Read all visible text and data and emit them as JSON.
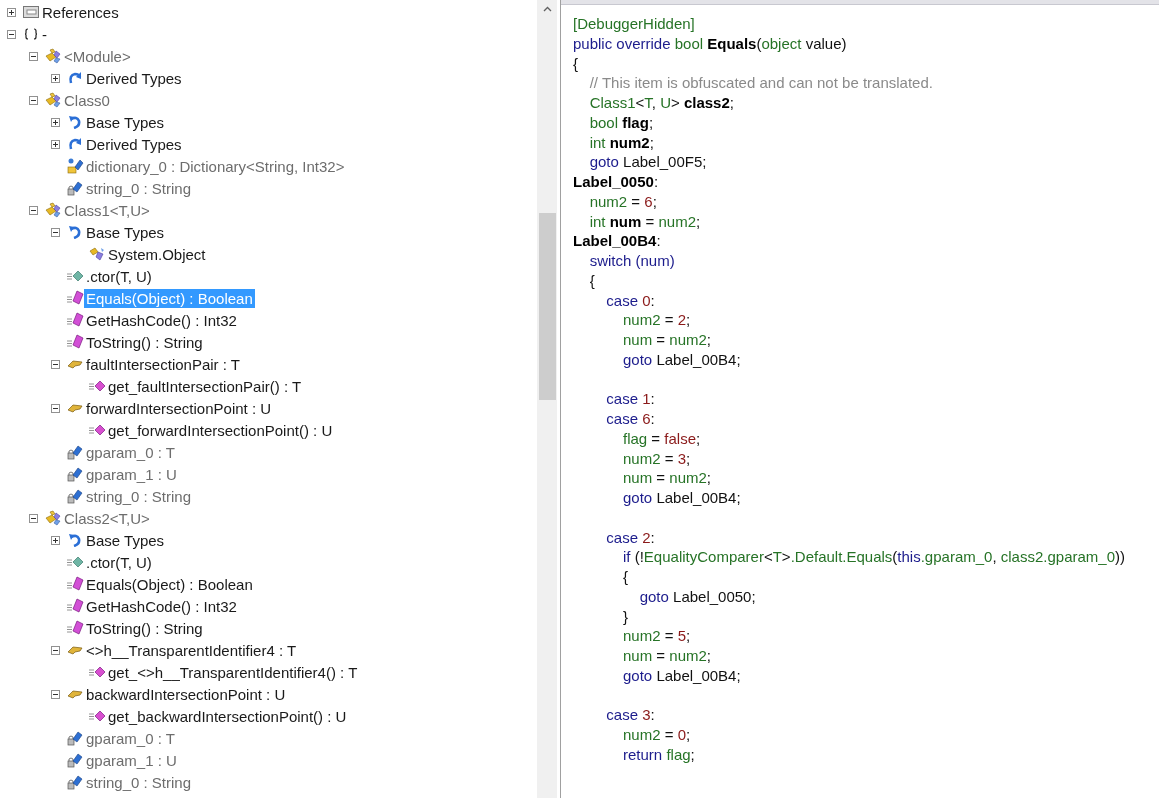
{
  "tree": [
    {
      "label": "References",
      "kind": "references",
      "dim": false,
      "selected": false,
      "expanded": false
    },
    {
      "label": "-",
      "kind": "namespace",
      "dim": false,
      "selected": false,
      "expanded": true,
      "children": [
        {
          "label": "<Module>",
          "kind": "class",
          "dim": true,
          "selected": false,
          "expanded": true,
          "children": [
            {
              "label": "Derived Types",
              "kind": "derived",
              "dim": false,
              "selected": false,
              "expanded": false
            }
          ]
        },
        {
          "label": "Class0",
          "kind": "class",
          "dim": true,
          "selected": false,
          "expanded": true,
          "children": [
            {
              "label": "Base Types",
              "kind": "base",
              "dim": false,
              "selected": false,
              "expanded": false
            },
            {
              "label": "Derived Types",
              "kind": "derived",
              "dim": false,
              "selected": false,
              "expanded": false
            },
            {
              "label": "dictionary_0 : Dictionary<String, Int32>",
              "kind": "static-field",
              "dim": true,
              "selected": false
            },
            {
              "label": "string_0 : String",
              "kind": "field",
              "dim": true,
              "selected": false
            }
          ]
        },
        {
          "label": "Class1<T,U>",
          "kind": "class",
          "dim": true,
          "selected": false,
          "expanded": true,
          "children": [
            {
              "label": "Base Types",
              "kind": "base",
              "dim": false,
              "selected": false,
              "expanded": true,
              "children": [
                {
                  "label": "System.Object",
                  "kind": "type-ref",
                  "dim": false,
                  "selected": false
                }
              ]
            },
            {
              "label": ".ctor(T, U)",
              "kind": "ctor",
              "dim": false,
              "selected": false
            },
            {
              "label": "Equals(Object) : Boolean",
              "kind": "method",
              "dim": false,
              "selected": true
            },
            {
              "label": "GetHashCode() : Int32",
              "kind": "method",
              "dim": false,
              "selected": false
            },
            {
              "label": "ToString() : String",
              "kind": "method",
              "dim": false,
              "selected": false
            },
            {
              "label": "faultIntersectionPair : T",
              "kind": "property",
              "dim": false,
              "selected": false,
              "expanded": true,
              "children": [
                {
                  "label": "get_faultIntersectionPair() : T",
                  "kind": "getter",
                  "dim": false,
                  "selected": false
                }
              ]
            },
            {
              "label": "forwardIntersectionPoint : U",
              "kind": "property",
              "dim": false,
              "selected": false,
              "expanded": true,
              "children": [
                {
                  "label": "get_forwardIntersectionPoint() : U",
                  "kind": "getter",
                  "dim": false,
                  "selected": false
                }
              ]
            },
            {
              "label": "gparam_0 : T",
              "kind": "field",
              "dim": true,
              "selected": false
            },
            {
              "label": "gparam_1 : U",
              "kind": "field",
              "dim": true,
              "selected": false
            },
            {
              "label": "string_0 : String",
              "kind": "field",
              "dim": true,
              "selected": false
            }
          ]
        },
        {
          "label": "Class2<T,U>",
          "kind": "class",
          "dim": true,
          "selected": false,
          "expanded": true,
          "children": [
            {
              "label": "Base Types",
              "kind": "base",
              "dim": false,
              "selected": false,
              "expanded": false
            },
            {
              "label": ".ctor(T, U)",
              "kind": "ctor",
              "dim": false,
              "selected": false
            },
            {
              "label": "Equals(Object) : Boolean",
              "kind": "method",
              "dim": false,
              "selected": false
            },
            {
              "label": "GetHashCode() : Int32",
              "kind": "method",
              "dim": false,
              "selected": false
            },
            {
              "label": "ToString() : String",
              "kind": "method",
              "dim": false,
              "selected": false
            },
            {
              "label": "<>h__TransparentIdentifier4 : T",
              "kind": "property",
              "dim": false,
              "selected": false,
              "expanded": true,
              "children": [
                {
                  "label": "get_<>h__TransparentIdentifier4() : T",
                  "kind": "getter",
                  "dim": false,
                  "selected": false
                }
              ]
            },
            {
              "label": "backwardIntersectionPoint : U",
              "kind": "property",
              "dim": false,
              "selected": false,
              "expanded": true,
              "children": [
                {
                  "label": "get_backwardIntersectionPoint() : U",
                  "kind": "getter",
                  "dim": false,
                  "selected": false
                }
              ]
            },
            {
              "label": "gparam_0 : T",
              "kind": "field",
              "dim": true,
              "selected": false
            },
            {
              "label": "gparam_1 : U",
              "kind": "field",
              "dim": true,
              "selected": false
            },
            {
              "label": "string_0 : String",
              "kind": "field",
              "dim": true,
              "selected": false
            }
          ]
        }
      ]
    }
  ],
  "code": [
    {
      "kind": "code",
      "tokens": [
        {
          "text": "[DebuggerHidden]",
          "kind": "type"
        }
      ]
    },
    {
      "kind": "code",
      "tokens": [
        {
          "text": "public override ",
          "kind": "kw"
        },
        {
          "text": "bool ",
          "kind": "type"
        },
        {
          "text": "Equals",
          "kind": "bold"
        },
        {
          "text": "(",
          "kind": "plain"
        },
        {
          "text": "object",
          "kind": "type"
        },
        {
          "text": " value)",
          "kind": "plain"
        }
      ]
    },
    {
      "kind": "code",
      "tokens": [
        {
          "text": "{",
          "kind": "plain"
        }
      ]
    },
    {
      "kind": "code",
      "tokens": [
        {
          "text": "    // This item is obfuscated and can not be translated.",
          "kind": "comment"
        }
      ]
    },
    {
      "kind": "code",
      "tokens": [
        {
          "text": "    Class1",
          "kind": "type"
        },
        {
          "text": "<",
          "kind": "plain"
        },
        {
          "text": "T",
          "kind": "type"
        },
        {
          "text": ", ",
          "kind": "plain"
        },
        {
          "text": "U",
          "kind": "type"
        },
        {
          "text": "> ",
          "kind": "plain"
        },
        {
          "text": "class2",
          "kind": "bold"
        },
        {
          "text": ";",
          "kind": "plain"
        }
      ]
    },
    {
      "kind": "code",
      "tokens": [
        {
          "text": "    bool ",
          "kind": "type"
        },
        {
          "text": "flag",
          "kind": "bold"
        },
        {
          "text": ";",
          "kind": "plain"
        }
      ]
    },
    {
      "kind": "code",
      "tokens": [
        {
          "text": "    int ",
          "kind": "type"
        },
        {
          "text": "num2",
          "kind": "bold"
        },
        {
          "text": ";",
          "kind": "plain"
        }
      ]
    },
    {
      "kind": "code",
      "tokens": [
        {
          "text": "    goto ",
          "kind": "kw"
        },
        {
          "text": "Label_00F5;",
          "kind": "plain"
        }
      ]
    },
    {
      "kind": "code",
      "tokens": [
        {
          "text": "Label_0050",
          "kind": "bold"
        },
        {
          "text": ":",
          "kind": "plain"
        }
      ]
    },
    {
      "kind": "code",
      "tokens": [
        {
          "text": "    num2",
          "kind": "type"
        },
        {
          "text": " = ",
          "kind": "plain"
        },
        {
          "text": "6",
          "kind": "num"
        },
        {
          "text": ";",
          "kind": "plain"
        }
      ]
    },
    {
      "kind": "code",
      "tokens": [
        {
          "text": "    int ",
          "kind": "type"
        },
        {
          "text": "num",
          "kind": "bold"
        },
        {
          "text": " = ",
          "kind": "plain"
        },
        {
          "text": "num2",
          "kind": "type"
        },
        {
          "text": ";",
          "kind": "plain"
        }
      ]
    },
    {
      "kind": "code",
      "tokens": [
        {
          "text": "Label_00B4",
          "kind": "bold"
        },
        {
          "text": ":",
          "kind": "plain"
        }
      ]
    },
    {
      "kind": "code",
      "tokens": [
        {
          "text": "    switch (num)",
          "kind": "kw"
        }
      ]
    },
    {
      "kind": "code",
      "tokens": [
        {
          "text": "    {",
          "kind": "plain"
        }
      ]
    },
    {
      "kind": "code",
      "tokens": [
        {
          "text": "        case ",
          "kind": "kw"
        },
        {
          "text": "0",
          "kind": "num"
        },
        {
          "text": ":",
          "kind": "plain"
        }
      ]
    },
    {
      "kind": "code",
      "tokens": [
        {
          "text": "            num2",
          "kind": "type"
        },
        {
          "text": " = ",
          "kind": "plain"
        },
        {
          "text": "2",
          "kind": "num"
        },
        {
          "text": ";",
          "kind": "plain"
        }
      ]
    },
    {
      "kind": "code",
      "tokens": [
        {
          "text": "            num",
          "kind": "type"
        },
        {
          "text": " = ",
          "kind": "plain"
        },
        {
          "text": "num2",
          "kind": "type"
        },
        {
          "text": ";",
          "kind": "plain"
        }
      ]
    },
    {
      "kind": "code",
      "tokens": [
        {
          "text": "            goto ",
          "kind": "kw"
        },
        {
          "text": "Label_00B4;",
          "kind": "plain"
        }
      ]
    },
    {
      "kind": "blank"
    },
    {
      "kind": "code",
      "tokens": [
        {
          "text": "        case ",
          "kind": "kw"
        },
        {
          "text": "1",
          "kind": "num"
        },
        {
          "text": ":",
          "kind": "plain"
        }
      ]
    },
    {
      "kind": "code",
      "tokens": [
        {
          "text": "        case ",
          "kind": "kw"
        },
        {
          "text": "6",
          "kind": "num"
        },
        {
          "text": ":",
          "kind": "plain"
        }
      ]
    },
    {
      "kind": "code",
      "tokens": [
        {
          "text": "            flag",
          "kind": "type"
        },
        {
          "text": " = ",
          "kind": "plain"
        },
        {
          "text": "false",
          "kind": "num"
        },
        {
          "text": ";",
          "kind": "plain"
        }
      ]
    },
    {
      "kind": "code",
      "tokens": [
        {
          "text": "            num2",
          "kind": "type"
        },
        {
          "text": " = ",
          "kind": "plain"
        },
        {
          "text": "3",
          "kind": "num"
        },
        {
          "text": ";",
          "kind": "plain"
        }
      ]
    },
    {
      "kind": "code",
      "tokens": [
        {
          "text": "            num",
          "kind": "type"
        },
        {
          "text": " = ",
          "kind": "plain"
        },
        {
          "text": "num2",
          "kind": "type"
        },
        {
          "text": ";",
          "kind": "plain"
        }
      ]
    },
    {
      "kind": "code",
      "tokens": [
        {
          "text": "            goto ",
          "kind": "kw"
        },
        {
          "text": "Label_00B4;",
          "kind": "plain"
        }
      ]
    },
    {
      "kind": "blank"
    },
    {
      "kind": "code",
      "tokens": [
        {
          "text": "        case ",
          "kind": "kw"
        },
        {
          "text": "2",
          "kind": "num"
        },
        {
          "text": ":",
          "kind": "plain"
        }
      ]
    },
    {
      "kind": "code",
      "tokens": [
        {
          "text": "            if ",
          "kind": "kw"
        },
        {
          "text": "(!",
          "kind": "plain"
        },
        {
          "text": "EqualityComparer",
          "kind": "type"
        },
        {
          "text": "<",
          "kind": "plain"
        },
        {
          "text": "T",
          "kind": "type"
        },
        {
          "text": ">",
          "kind": "plain"
        },
        {
          "text": ".Default.Equals",
          "kind": "type"
        },
        {
          "text": "(",
          "kind": "plain"
        },
        {
          "text": "this",
          "kind": "kw"
        },
        {
          "text": ".gparam_0",
          "kind": "type"
        },
        {
          "text": ", ",
          "kind": "plain"
        },
        {
          "text": "class2.gparam_0",
          "kind": "type"
        },
        {
          "text": "))",
          "kind": "plain"
        }
      ]
    },
    {
      "kind": "code",
      "tokens": [
        {
          "text": "            {",
          "kind": "plain"
        }
      ]
    },
    {
      "kind": "code",
      "tokens": [
        {
          "text": "                goto ",
          "kind": "kw"
        },
        {
          "text": "Label_0050;",
          "kind": "plain"
        }
      ]
    },
    {
      "kind": "code",
      "tokens": [
        {
          "text": "            }",
          "kind": "plain"
        }
      ]
    },
    {
      "kind": "code",
      "tokens": [
        {
          "text": "            num2",
          "kind": "type"
        },
        {
          "text": " = ",
          "kind": "plain"
        },
        {
          "text": "5",
          "kind": "num"
        },
        {
          "text": ";",
          "kind": "plain"
        }
      ]
    },
    {
      "kind": "code",
      "tokens": [
        {
          "text": "            num",
          "kind": "type"
        },
        {
          "text": " = ",
          "kind": "plain"
        },
        {
          "text": "num2",
          "kind": "type"
        },
        {
          "text": ";",
          "kind": "plain"
        }
      ]
    },
    {
      "kind": "code",
      "tokens": [
        {
          "text": "            goto ",
          "kind": "kw"
        },
        {
          "text": "Label_00B4;",
          "kind": "plain"
        }
      ]
    },
    {
      "kind": "blank"
    },
    {
      "kind": "code",
      "tokens": [
        {
          "text": "        case ",
          "kind": "kw"
        },
        {
          "text": "3",
          "kind": "num"
        },
        {
          "text": ":",
          "kind": "plain"
        }
      ]
    },
    {
      "kind": "code",
      "tokens": [
        {
          "text": "            num2",
          "kind": "type"
        },
        {
          "text": " = ",
          "kind": "plain"
        },
        {
          "text": "0",
          "kind": "num"
        },
        {
          "text": ";",
          "kind": "plain"
        }
      ]
    },
    {
      "kind": "code",
      "tokens": [
        {
          "text": "            return ",
          "kind": "kw"
        },
        {
          "text": "flag",
          "kind": "type"
        },
        {
          "text": ";",
          "kind": "plain"
        }
      ]
    }
  ]
}
